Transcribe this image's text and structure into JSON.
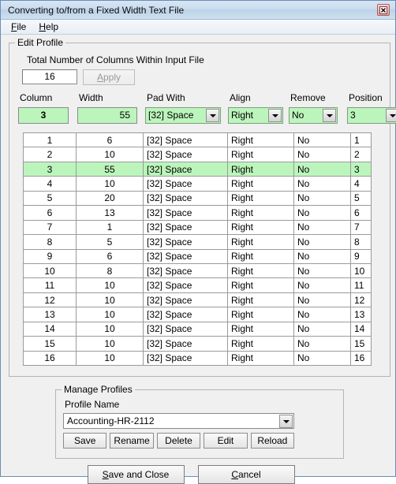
{
  "window": {
    "title": "Converting to/from a Fixed Width Text File",
    "close_icon": "close-icon"
  },
  "menu": {
    "items": [
      {
        "label": "File",
        "accel": "F"
      },
      {
        "label": "Help",
        "accel": "H"
      }
    ]
  },
  "edit_profile": {
    "group_label": "Edit Profile",
    "total_columns_label": "Total Number of Columns Within Input File",
    "total_columns_value": "16",
    "apply_label": "Apply",
    "apply_accel": "A",
    "apply_enabled": "false",
    "editors": [
      {
        "label": "Column",
        "value": "3",
        "type": "textbox"
      },
      {
        "label": "Width",
        "value": "55",
        "type": "textbox"
      },
      {
        "label": "Pad With",
        "value": "[32] Space",
        "type": "combobox"
      },
      {
        "label": "Align",
        "value": "Right",
        "type": "combobox"
      },
      {
        "label": "Remove",
        "value": "No",
        "type": "combobox"
      },
      {
        "label": "Position",
        "value": "3",
        "type": "combobox"
      }
    ],
    "grid": {
      "columns": [
        "Column",
        "Width",
        "Pad With",
        "Align",
        "Remove",
        "Position"
      ],
      "selected_row": 3,
      "rows": [
        {
          "column": "1",
          "width": "6",
          "pad_with": "[32] Space",
          "align": "Right",
          "remove": "No",
          "position": "1"
        },
        {
          "column": "2",
          "width": "10",
          "pad_with": "[32] Space",
          "align": "Right",
          "remove": "No",
          "position": "2"
        },
        {
          "column": "3",
          "width": "55",
          "pad_with": "[32] Space",
          "align": "Right",
          "remove": "No",
          "position": "3"
        },
        {
          "column": "4",
          "width": "10",
          "pad_with": "[32] Space",
          "align": "Right",
          "remove": "No",
          "position": "4"
        },
        {
          "column": "5",
          "width": "20",
          "pad_with": "[32] Space",
          "align": "Right",
          "remove": "No",
          "position": "5"
        },
        {
          "column": "6",
          "width": "13",
          "pad_with": "[32] Space",
          "align": "Right",
          "remove": "No",
          "position": "6"
        },
        {
          "column": "7",
          "width": "1",
          "pad_with": "[32] Space",
          "align": "Right",
          "remove": "No",
          "position": "7"
        },
        {
          "column": "8",
          "width": "5",
          "pad_with": "[32] Space",
          "align": "Right",
          "remove": "No",
          "position": "8"
        },
        {
          "column": "9",
          "width": "6",
          "pad_with": "[32] Space",
          "align": "Right",
          "remove": "No",
          "position": "9"
        },
        {
          "column": "10",
          "width": "8",
          "pad_with": "[32] Space",
          "align": "Right",
          "remove": "No",
          "position": "10"
        },
        {
          "column": "11",
          "width": "10",
          "pad_with": "[32] Space",
          "align": "Right",
          "remove": "No",
          "position": "11"
        },
        {
          "column": "12",
          "width": "10",
          "pad_with": "[32] Space",
          "align": "Right",
          "remove": "No",
          "position": "12"
        },
        {
          "column": "13",
          "width": "10",
          "pad_with": "[32] Space",
          "align": "Right",
          "remove": "No",
          "position": "13"
        },
        {
          "column": "14",
          "width": "10",
          "pad_with": "[32] Space",
          "align": "Right",
          "remove": "No",
          "position": "14"
        },
        {
          "column": "15",
          "width": "10",
          "pad_with": "[32] Space",
          "align": "Right",
          "remove": "No",
          "position": "15"
        },
        {
          "column": "16",
          "width": "10",
          "pad_with": "[32] Space",
          "align": "Right",
          "remove": "No",
          "position": "16"
        }
      ]
    }
  },
  "manage_profiles": {
    "group_label": "Manage Profiles",
    "profile_name_label": "Profile Name",
    "profile_name_value": "Accounting-HR-2112",
    "buttons": [
      "Save",
      "Rename",
      "Delete",
      "Edit",
      "Reload"
    ]
  },
  "footer": {
    "save_and_close": {
      "label": "Save and Close",
      "accel": "S"
    },
    "cancel": {
      "label": "Cancel",
      "accel": "C"
    }
  },
  "colors": {
    "highlight_green": "#bcf5bc",
    "window_bg": "#f0f0f0",
    "titlebar": "#c9dcef"
  }
}
